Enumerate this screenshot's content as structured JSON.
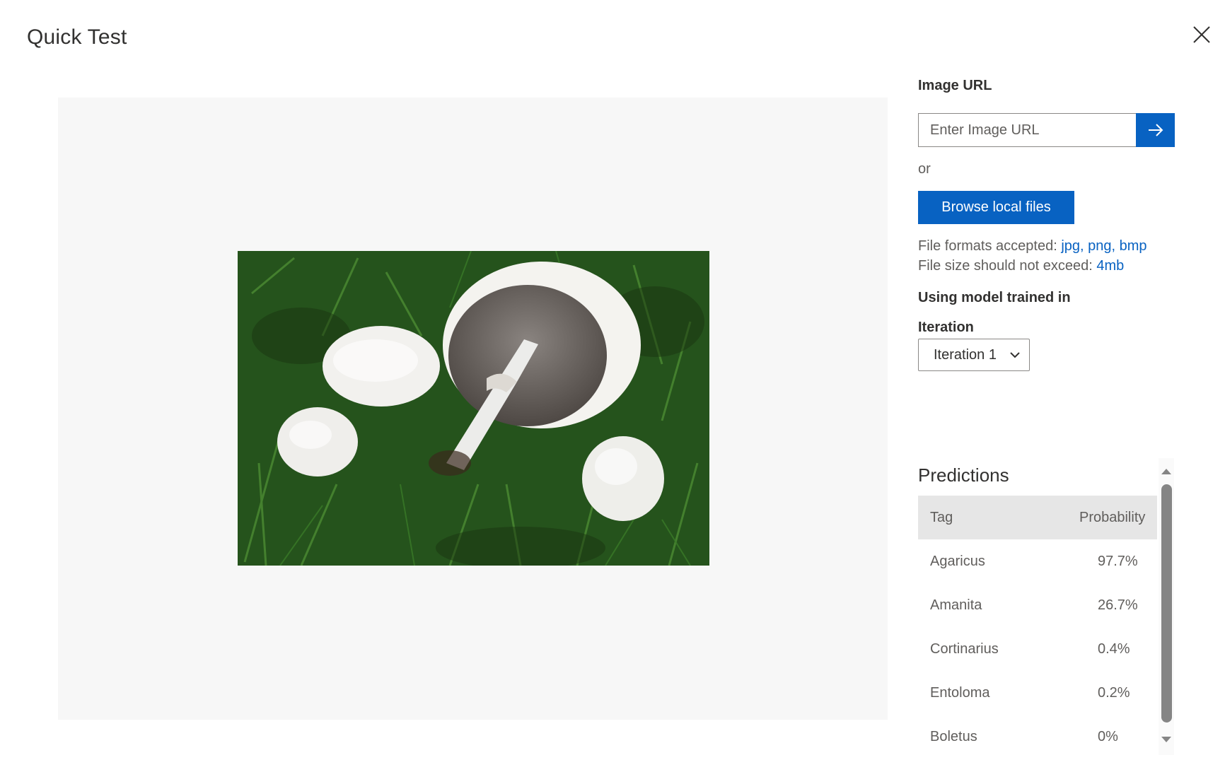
{
  "dialog": {
    "title": "Quick Test"
  },
  "image_url": {
    "label": "Image URL",
    "placeholder": "Enter Image URL",
    "value": ""
  },
  "or_text": "or",
  "browse_label": "Browse local files",
  "file_info": {
    "formats_prefix": "File formats accepted: ",
    "formats_value": "jpg, png, bmp",
    "size_prefix": "File size should not exceed: ",
    "size_value": "4mb"
  },
  "model": {
    "label": "Using model trained in",
    "iteration_label": "Iteration",
    "iteration_selected": "Iteration 1"
  },
  "predictions": {
    "title": "Predictions",
    "headers": {
      "tag": "Tag",
      "probability": "Probability"
    },
    "rows": [
      {
        "tag": "Agaricus",
        "probability": "97.7%"
      },
      {
        "tag": "Amanita",
        "probability": "26.7%"
      },
      {
        "tag": "Cortinarius",
        "probability": "0.4%"
      },
      {
        "tag": "Entoloma",
        "probability": "0.2%"
      },
      {
        "tag": "Boletus",
        "probability": "0%"
      }
    ]
  },
  "colors": {
    "accent": "#0862c2",
    "preview_background": "#f7f7f7",
    "table_header": "#e6e6e6"
  },
  "icons": {
    "close": "close-icon",
    "submit": "arrow-right-icon",
    "dropdown": "chevron-down-icon",
    "scroll_up": "caret-up-icon",
    "scroll_down": "caret-down-icon"
  }
}
